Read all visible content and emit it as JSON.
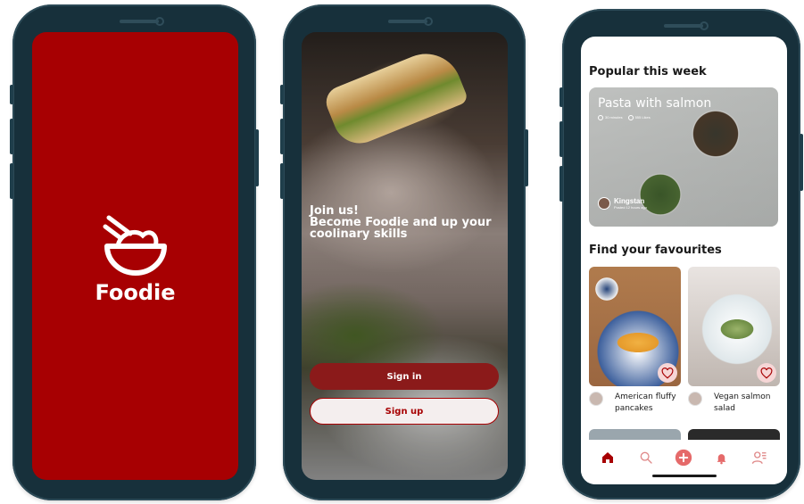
{
  "theme": {
    "brand": "#a70002",
    "brand_dark": "#8b1a1a",
    "accent_soft": "#f6d6d6",
    "frame": "#17303b"
  },
  "splash": {
    "app_name": "Foodie",
    "logo_icon": "bowl-with-spoon-icon"
  },
  "onboarding": {
    "headline_line1": "Join us!",
    "headline_line2": "Become Foodie and up your",
    "headline_line3": "coolinary skills",
    "sign_in_label": "Sign in",
    "sign_up_label": "Sign up"
  },
  "home": {
    "popular_title": "Popular this week",
    "popular_card": {
      "title": "Pasta with salmon",
      "time": "30 minutes",
      "likes": "555 Likes",
      "author": "Kingstan",
      "author_meta": "Posted 12 hours ago"
    },
    "favourites_title": "Find your favourites",
    "favourites": [
      {
        "name_line1": "American fluffy",
        "name_line2": "pancakes"
      },
      {
        "name_line1": "Vegan salmon",
        "name_line2": "salad"
      }
    ],
    "tabbar": [
      "home-icon",
      "search-icon",
      "add-icon",
      "bell-icon",
      "profile-list-icon"
    ]
  }
}
